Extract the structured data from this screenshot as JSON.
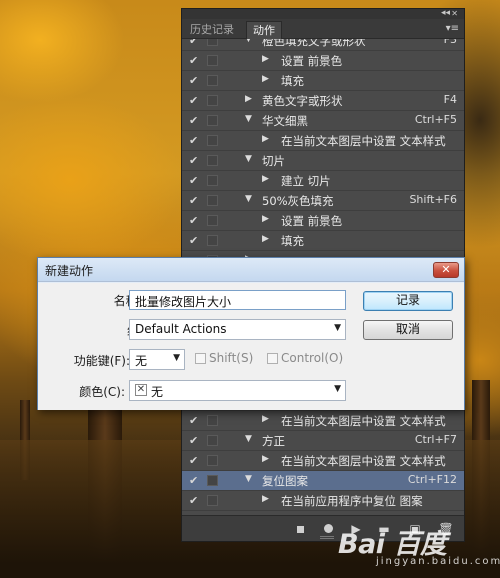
{
  "panel": {
    "tabs": [
      {
        "label": "历史记录",
        "active": false
      },
      {
        "label": "动作",
        "active": true
      }
    ],
    "rows": [
      {
        "label": "橙色填充文字或形状",
        "level": 1,
        "checked": true,
        "expanded": true,
        "shortcut": "F3",
        "highlight": false
      },
      {
        "label": "设置 前景色",
        "level": 2,
        "checked": true,
        "expanded": false,
        "shortcut": "",
        "highlight": false
      },
      {
        "label": "填充",
        "level": 2,
        "checked": true,
        "expanded": false,
        "shortcut": "",
        "highlight": false
      },
      {
        "label": "黄色文字或形状",
        "level": 1,
        "checked": true,
        "expanded": false,
        "shortcut": "F4",
        "highlight": false
      },
      {
        "label": "华文细黑",
        "level": 1,
        "checked": true,
        "expanded": true,
        "shortcut": "Ctrl+F5",
        "highlight": false
      },
      {
        "label": "在当前文本图层中设置 文本样式",
        "level": 2,
        "checked": true,
        "expanded": false,
        "shortcut": "",
        "highlight": false
      },
      {
        "label": "切片",
        "level": 1,
        "checked": true,
        "expanded": true,
        "shortcut": "",
        "highlight": false
      },
      {
        "label": "建立 切片",
        "level": 2,
        "checked": true,
        "expanded": false,
        "shortcut": "",
        "highlight": false
      },
      {
        "label": "50%灰色填充",
        "level": 1,
        "checked": true,
        "expanded": true,
        "shortcut": "Shift+F6",
        "highlight": false
      },
      {
        "label": "设置 前景色",
        "level": 2,
        "checked": true,
        "expanded": false,
        "shortcut": "",
        "highlight": false
      },
      {
        "label": "填充",
        "level": 2,
        "checked": true,
        "expanded": false,
        "shortcut": "",
        "highlight": false
      },
      {
        "label": "",
        "level": 1,
        "checked": true,
        "expanded": false,
        "shortcut": "",
        "highlight": false
      },
      {
        "label": "",
        "level": 1,
        "checked": true,
        "expanded": false,
        "shortcut": "",
        "highlight": false
      },
      {
        "label": "",
        "level": 1,
        "checked": true,
        "expanded": false,
        "shortcut": "",
        "highlight": false
      },
      {
        "label": "",
        "level": 1,
        "checked": true,
        "expanded": false,
        "shortcut": "",
        "highlight": false
      },
      {
        "label": "",
        "level": 1,
        "checked": true,
        "expanded": false,
        "shortcut": "",
        "highlight": false
      },
      {
        "label": "",
        "level": 1,
        "checked": true,
        "expanded": false,
        "shortcut": "",
        "highlight": false
      },
      {
        "label": "",
        "level": 1,
        "checked": true,
        "expanded": false,
        "shortcut": "",
        "highlight": false
      },
      {
        "label": "",
        "level": 1,
        "checked": true,
        "expanded": false,
        "shortcut": "",
        "highlight": false
      },
      {
        "label": "在当前文本图层中设置 文本样式",
        "level": 2,
        "checked": true,
        "expanded": false,
        "shortcut": "",
        "highlight": false
      },
      {
        "label": "方正",
        "level": 1,
        "checked": true,
        "expanded": true,
        "shortcut": "Ctrl+F7",
        "highlight": false
      },
      {
        "label": "在当前文本图层中设置 文本样式",
        "level": 2,
        "checked": true,
        "expanded": false,
        "shortcut": "",
        "highlight": false
      },
      {
        "label": "复位图案",
        "level": 1,
        "checked": true,
        "expanded": true,
        "shortcut": "Ctrl+F12",
        "highlight": true
      },
      {
        "label": "在当前应用程序中复位 图案",
        "level": 2,
        "checked": true,
        "expanded": false,
        "shortcut": "",
        "highlight": false
      }
    ],
    "toolbar": [
      "stop-icon",
      "record-icon",
      "play-icon",
      "folder-icon",
      "new-action-icon",
      "trash-icon"
    ]
  },
  "dialog": {
    "title": "新建动作",
    "close_label": "✕",
    "name_label": "名称(N):",
    "name_value": "批量修改图片大小",
    "set_label": "组(E):",
    "set_value": "Default Actions",
    "fkey_label": "功能键(F):",
    "fkey_value": "无",
    "shift_label": "Shift(S)",
    "control_label": "Control(O)",
    "color_label": "颜色(C):",
    "color_value": "无",
    "record_button": "记录",
    "cancel_button": "取消"
  },
  "watermark": {
    "logo": "Bai  百度",
    "sub": "jingyan.baidu.com"
  }
}
